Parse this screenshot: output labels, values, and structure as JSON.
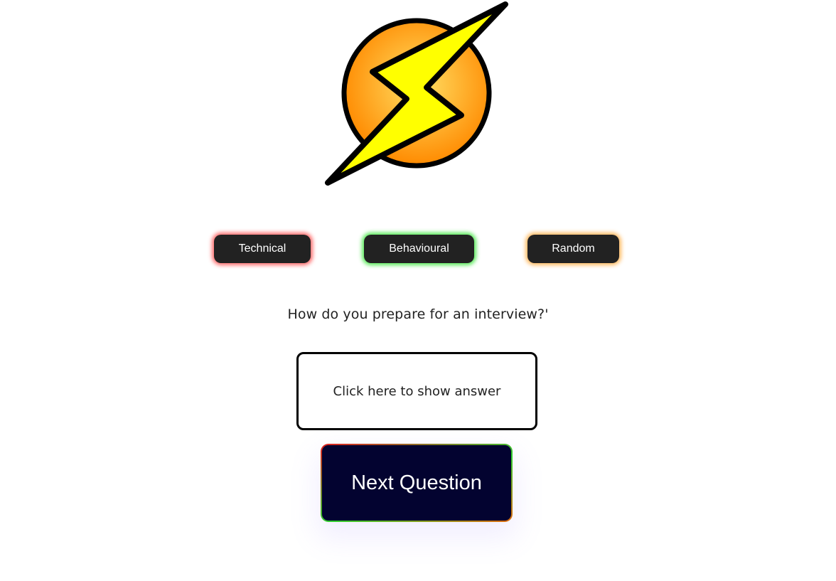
{
  "logo": {
    "icon": "lightning-bolt-logo",
    "circle_color_inner": "#ffd25a",
    "circle_color_outer": "#ff8a00",
    "bolt_color": "#ffff00"
  },
  "categories": [
    {
      "label": "Technical",
      "glow_color": "#ff3c3c"
    },
    {
      "label": "Behavioural",
      "glow_color": "#3ce63c"
    },
    {
      "label": "Random",
      "glow_color": "#ffaa3c"
    }
  ],
  "question": {
    "text": "How do you prepare for an interview?'"
  },
  "answer": {
    "placeholder_text": "Click here to show answer"
  },
  "next_button": {
    "label": "Next Question",
    "background": "#030330"
  }
}
